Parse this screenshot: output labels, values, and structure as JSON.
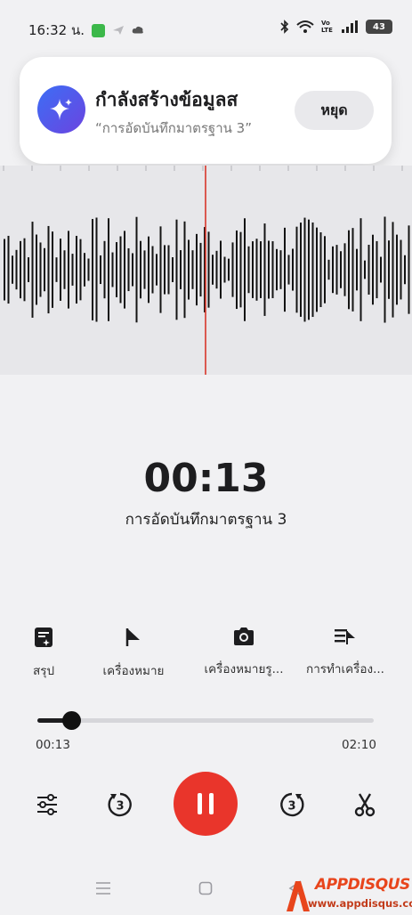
{
  "status_bar": {
    "time": "16:32 น.",
    "battery": "43",
    "network_label": "Vo LTE"
  },
  "notification": {
    "title": "กำลังสร้างข้อมูลส",
    "subtitle": "“การอัดบันทึกมาตรฐาน 3”",
    "stop_label": "หยุด",
    "icon": "sparkle-icon"
  },
  "recording": {
    "elapsed": "00:13",
    "name": "การอัดบันทึกมาตรฐาน 3"
  },
  "toolbar": {
    "items": [
      {
        "label": "สรุป",
        "icon": "summary-icon"
      },
      {
        "label": "เครื่องหมาย",
        "icon": "flag-icon"
      },
      {
        "label": "เครื่องหมายรู...",
        "icon": "camera-icon"
      },
      {
        "label": "การทำเครื่อง...",
        "icon": "mark-list-icon"
      }
    ]
  },
  "playback": {
    "current": "00:13",
    "total": "02:10",
    "progress_fraction": 0.1
  },
  "controls": {
    "settings_icon": "sliders-icon",
    "rewind_icon": "rewind-3-icon",
    "rewind_label": "3",
    "pause_icon": "pause-icon",
    "forward_icon": "forward-3-icon",
    "forward_label": "3",
    "cut_icon": "scissors-icon"
  },
  "navigation": {
    "menu_icon": "menu-icon",
    "home_icon": "home-icon",
    "back_icon": "back-icon"
  },
  "watermark": {
    "brand": "APPDISQUS",
    "url": "www.appdisqus.com"
  },
  "colors": {
    "accent_red": "#e9352b",
    "playhead": "#d8362a",
    "notif_icon": "#4a5ce8"
  }
}
